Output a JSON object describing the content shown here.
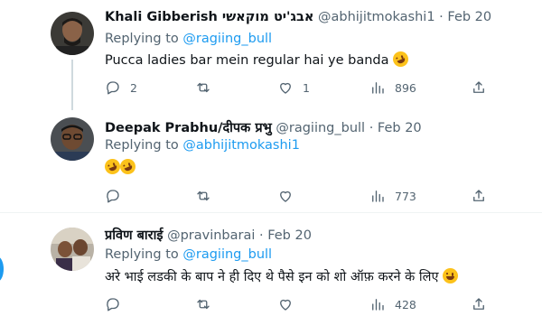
{
  "tweets": [
    {
      "display_name": "Khali Gibberish אבג'יט מוקאשי",
      "handle": "@abhijitmokashi1",
      "dot": "·",
      "date": "Feb 20",
      "replying_prefix": "Replying to",
      "replying_to": "@ragiing_bull",
      "text": "Pucca ladies bar mein regular hai ye banda",
      "emoji": "rolling-on-floor-laughing",
      "replies": "2",
      "retweets": "",
      "likes": "1",
      "views": "896"
    },
    {
      "display_name": "Deepak Prabhu/दीपक प्रभु",
      "handle": "@ragiing_bull",
      "dot": "·",
      "date": "Feb 20",
      "replying_prefix": "Replying to",
      "replying_to": "@abhijitmokashi1",
      "text": "",
      "emoji": "rolling-on-floor-laughing x2",
      "replies": "",
      "retweets": "",
      "likes": "",
      "views": "773"
    },
    {
      "display_name": "प्रविण बाराई",
      "handle": "@pravinbarai",
      "dot": "·",
      "date": "Feb 20",
      "replying_prefix": "Replying to",
      "replying_to": "@ragiing_bull",
      "text": "अरे भाई लडकी के बाप ने ही दिए थे पैसे इन को शो ऑफ़ करने के लिए",
      "emoji": "grinning-face",
      "replies": "",
      "retweets": "",
      "likes": "",
      "views": "428"
    }
  ],
  "colors": {
    "accent": "#1d9bf0",
    "secondary_text": "#536471",
    "primary_text": "#0f1419"
  },
  "icons": [
    "reply-icon",
    "retweet-icon",
    "like-icon",
    "views-icon",
    "share-icon"
  ]
}
